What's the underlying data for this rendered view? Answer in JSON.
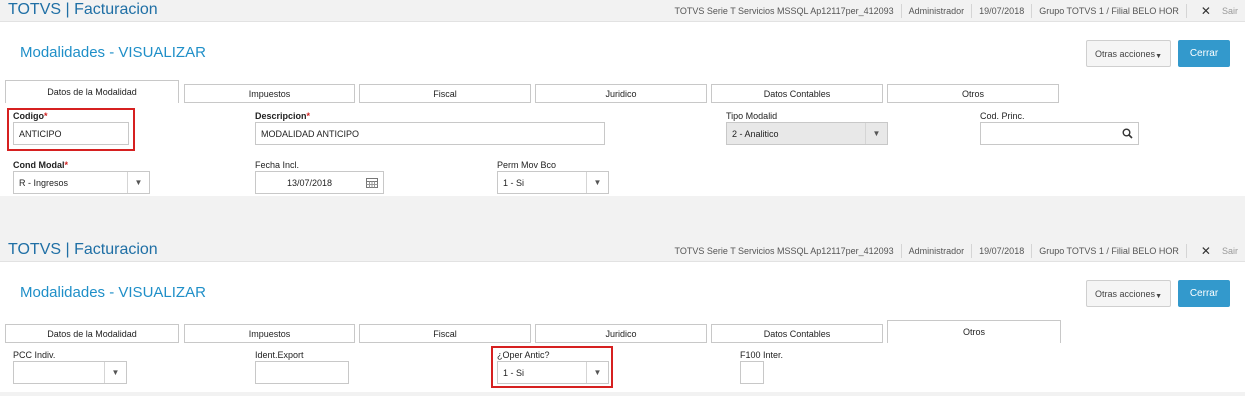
{
  "panel1": {
    "app_title": "TOTVS | Facturacion",
    "topinfo": {
      "env": "TOTVS Serie T Servicios MSSQL Ap12117per_412093",
      "user": "Administrador",
      "date": "19/07/2018",
      "branch": "Grupo TOTVS 1 / Filial BELO HOR",
      "logout": "Sair"
    },
    "page_title": "Modalidades - VISUALIZAR",
    "otras_label": "Otras acciones",
    "cerrar_label": "Cerrar",
    "tabs": [
      "Datos de la Modalidad",
      "Impuestos",
      "Fiscal",
      "Juridico",
      "Datos Contables",
      "Otros"
    ],
    "active_tab": "Datos de la Modalidad",
    "fields": {
      "codigo_label": "Codigo",
      "codigo_value": "ANTICIPO",
      "descripcion_label": "Descripcion",
      "descripcion_value": "MODALIDAD ANTICIPO",
      "tipo_label": "Tipo Modalid",
      "tipo_value": "2 - Analitico",
      "codprinc_label": "Cod. Princ.",
      "codprinc_value": "",
      "condmodal_label": "Cond Modal",
      "condmodal_value": "R - Ingresos",
      "fechaincl_label": "Fecha Incl.",
      "fechaincl_value": "13/07/2018",
      "permmov_label": "Perm Mov Bco",
      "permmov_value": "1 - Si"
    }
  },
  "panel2": {
    "app_title": "TOTVS | Facturacion",
    "topinfo": {
      "env": "TOTVS Serie T Servicios MSSQL Ap12117per_412093",
      "user": "Administrador",
      "date": "19/07/2018",
      "branch": "Grupo TOTVS 1 / Filial BELO HOR",
      "logout": "Sair"
    },
    "page_title": "Modalidades - VISUALIZAR",
    "otras_label": "Otras acciones",
    "cerrar_label": "Cerrar",
    "tabs": [
      "Datos de la Modalidad",
      "Impuestos",
      "Fiscal",
      "Juridico",
      "Datos Contables",
      "Otros"
    ],
    "active_tab": "Otros",
    "fields": {
      "pcc_label": "PCC Indiv.",
      "pcc_value": "",
      "ident_label": "Ident.Export",
      "ident_value": "",
      "oper_label": "¿Oper Antic?",
      "oper_value": "1 - Si",
      "f100_label": "F100 Inter.",
      "f100_value": ""
    }
  },
  "icons": {
    "close": "close-icon",
    "search": "search-icon",
    "calendar": "calendar-icon",
    "dropdown": "chevron-down-icon"
  },
  "colors": {
    "title_blue": "#1f6fa5",
    "page_title_blue": "#1f8fc8",
    "button_blue": "#3399cc",
    "highlight_red": "#d62020",
    "required_red": "#d02020"
  }
}
